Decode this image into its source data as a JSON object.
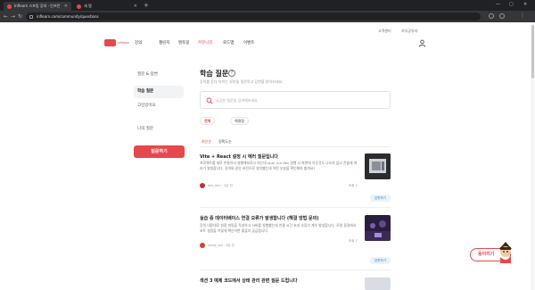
{
  "browser": {
    "tabs": [
      {
        "title": "Inflearn 스프링 강의 - 인프런",
        "active": true
      },
      {
        "title": "새 탭",
        "active": false
      }
    ],
    "new_tab": "+",
    "url": "inflearn.com/community/questions",
    "window_controls": [
      "—",
      "▢",
      "✕"
    ]
  },
  "header": {
    "utility_links": [
      "고객센터",
      "지식공유자"
    ],
    "logo_text": "inflearn",
    "nav": [
      {
        "label": "강의",
        "hot": false
      },
      {
        "label": "챌린지",
        "hot": false
      },
      {
        "label": "멘토링",
        "hot": false
      },
      {
        "label": "커뮤니티",
        "hot": true
      },
      {
        "label": "로드맵",
        "hot": false
      },
      {
        "label": "이벤트",
        "hot": false
      }
    ]
  },
  "sidebar": {
    "items": [
      {
        "label": "질문 & 답변",
        "active": false
      },
      {
        "label": "학습 질문",
        "active": true
      },
      {
        "label": "고민있어요",
        "active": false
      },
      {
        "label": "나의 질문",
        "active": false
      }
    ],
    "ask_button": "질문하기"
  },
  "main": {
    "title": "학습 질문",
    "help_icon": "?",
    "description": "강의를 듣다 막히는 부분을 질문하고 답변을 받아보세요.",
    "search": {
      "placeholder": "궁금한 질문을 검색해보세요",
      "value": ""
    },
    "filters": [
      {
        "label": "전체",
        "count": "",
        "hot": true
      },
      {
        "label": "해결됨",
        "count": "",
        "hot": false
      }
    ],
    "sort": [
      {
        "label": "최신순",
        "hot": true
      },
      {
        "label": "정확도순",
        "hot": false
      }
    ],
    "questions": [
      {
        "title": "Vite + React 설정 시 에러 질문입니다",
        "body": "프로젝트를 새로 만들어서 실행해보려고 하는데 npm run dev 실행 시 화면에 아무것도 나오지 않고 콘솔에 에러가 발생합니다. 강의와 같은 버전으로 설치했는데 어떤 부분을 확인해야 할까요?",
        "author": "dev_kim · 2분 전",
        "stats": "조회 3",
        "answer": "답변하기"
      },
      {
        "title": "실습 중 데이터베이스 연결 오류가 발생합니다 (해결 방법 문의)",
        "body": "강의 내용대로 설정 파일을 작성하고 서버를 실행했는데 연결 시간 초과 오류가 계속 발생합니다. 로컬 환경에서 포트 설정을 어떻게 확인하면 좋을지 궁금합니다.",
        "author": "study_lee · 5분 전",
        "stats": "조회 7",
        "answer": "답변하기"
      },
      {
        "title": "섹션 3 예제 코드에서 상태 관리 관련 질문 드립니다",
        "body": "",
        "author": "",
        "stats": "",
        "answer": "답변하기"
      }
    ]
  },
  "chat": {
    "label": "동아리기"
  },
  "colors": {
    "brand": "#e5484d",
    "answer_bg": "#e8f3fb",
    "answer_text": "#3a7bbf"
  }
}
